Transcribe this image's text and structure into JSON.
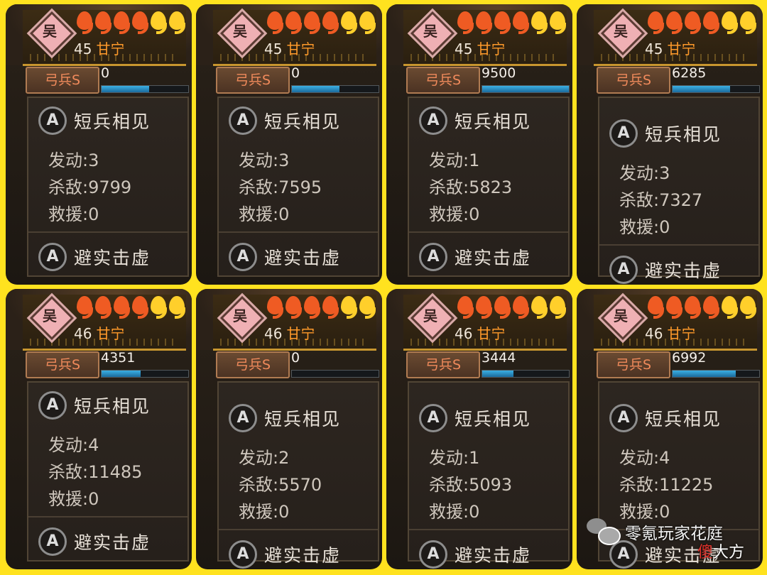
{
  "cards": [
    {
      "faction": "吴",
      "pips": [
        "red",
        "red",
        "red",
        "red",
        "yellow",
        "yellow"
      ],
      "level": "45",
      "name": "甘宁",
      "unit": "弓兵S",
      "count": "0",
      "progress": 0.55,
      "skill1": "短兵相见",
      "trigger": "发动:3",
      "kills": "杀敌:9799",
      "rescue": "救援:0",
      "skill2": "避实击虚"
    },
    {
      "faction": "吴",
      "pips": [
        "red",
        "red",
        "red",
        "red",
        "yellow",
        "yellow"
      ],
      "level": "45",
      "name": "甘宁",
      "unit": "弓兵S",
      "count": "0",
      "progress": 0.55,
      "skill1": "短兵相见",
      "trigger": "发动:3",
      "kills": "杀敌:7595",
      "rescue": "救援:0",
      "skill2": "避实击虚"
    },
    {
      "faction": "吴",
      "pips": [
        "red",
        "red",
        "red",
        "red",
        "yellow",
        "yellow"
      ],
      "level": "45",
      "name": "甘宁",
      "unit": "弓兵S",
      "count": "9500",
      "progress": 1.0,
      "skill1": "短兵相见",
      "trigger": "发动:1",
      "kills": "杀敌:5823",
      "rescue": "救援:0",
      "skill2": "避实击虚"
    },
    {
      "faction": "吴",
      "pips": [
        "red",
        "red",
        "red",
        "red",
        "yellow",
        "yellow"
      ],
      "level": "45",
      "name": "甘宁",
      "unit": "弓兵S",
      "count": "6285",
      "progress": 0.66,
      "skill1": "短兵相见",
      "trigger": "发动:3",
      "kills": "杀敌:7327",
      "rescue": "救援:0",
      "skill2": "避实击虚"
    },
    {
      "faction": "吴",
      "pips": [
        "red",
        "red",
        "red",
        "red",
        "yellow",
        "yellow"
      ],
      "level": "46",
      "name": "甘宁",
      "unit": "弓兵S",
      "count": "4351",
      "progress": 0.45,
      "skill1": "短兵相见",
      "trigger": "发动:4",
      "kills": "杀敌:11485",
      "rescue": "救援:0",
      "skill2": "避实击虚"
    },
    {
      "faction": "吴",
      "pips": [
        "red",
        "red",
        "red",
        "red",
        "yellow",
        "yellow"
      ],
      "level": "46",
      "name": "甘宁",
      "unit": "弓兵S",
      "count": "0",
      "progress": 0.0,
      "skill1": "短兵相见",
      "trigger": "发动:2",
      "kills": "杀敌:5570",
      "rescue": "救援:0",
      "skill2": "避实击虚"
    },
    {
      "faction": "吴",
      "pips": [
        "red",
        "red",
        "red",
        "red",
        "yellow",
        "yellow"
      ],
      "level": "46",
      "name": "甘宁",
      "unit": "弓兵S",
      "count": "3444",
      "progress": 0.36,
      "skill1": "短兵相见",
      "trigger": "发动:1",
      "kills": "杀敌:5093",
      "rescue": "救援:0",
      "skill2": "避实击虚"
    },
    {
      "faction": "吴",
      "pips": [
        "red",
        "red",
        "red",
        "red",
        "yellow",
        "yellow"
      ],
      "level": "46",
      "name": "甘宁",
      "unit": "弓兵S",
      "count": "6992",
      "progress": 0.73,
      "skill1": "短兵相见",
      "trigger": "发动:4",
      "kills": "杀敌:11225",
      "rescue": "救援:0",
      "skill2": "避实击虚"
    }
  ],
  "watermark": {
    "text": "零氪玩家花庭",
    "logo_red": "傻",
    "logo_rest": "大方"
  },
  "colors": {
    "background": "#ffe21f",
    "pip_red": "#ef5b23",
    "pip_yellow": "#ffcf2b",
    "name": "#ff9a2a",
    "bar": "#3bb0e3"
  }
}
